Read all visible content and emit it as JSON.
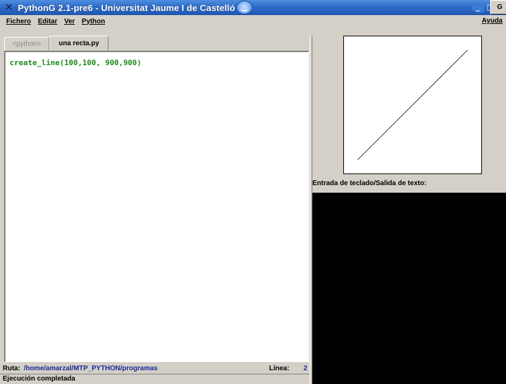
{
  "window": {
    "title": "PythonG 2.1-pre6 - Universitat Jaume I de Castelló",
    "controls": [
      "_",
      "□",
      "×"
    ]
  },
  "menu": {
    "items": [
      "Fichero",
      "Editar",
      "Ver",
      "Python"
    ],
    "help": "Ayuda"
  },
  "editor": {
    "tabs": [
      "<python>",
      "una recta.py"
    ],
    "active_tab": "una recta.py",
    "code": "create_line(100,100, 900,900)"
  },
  "status": {
    "path_label": "Ruta:",
    "path": "/home/amarzal/MTP_PYTHON/programas",
    "line_label": "Línea:",
    "line_value": "2",
    "message": "Ejecución completada"
  },
  "io": {
    "label": "Entrada de teclado/Salida de texto:",
    "button": "G"
  },
  "colors": {
    "titlebar": "#2e6bc8",
    "code_text": "#1a8a1a",
    "status_value": "#1a2a9a",
    "console_bg": "#000000"
  },
  "icons": {
    "app": "x-logo-icon",
    "title_decor": "swirl-icon"
  }
}
